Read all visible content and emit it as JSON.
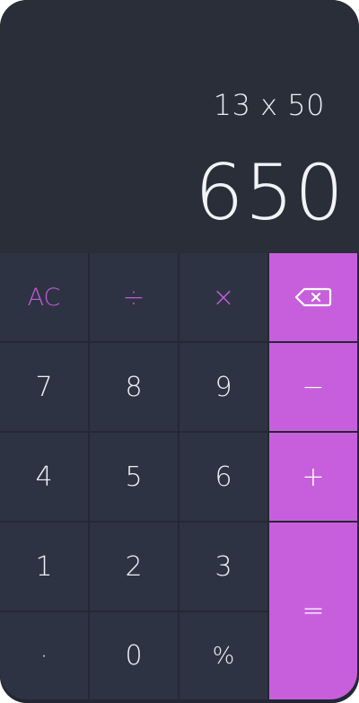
{
  "display": {
    "expression": "13 x 50",
    "result": "650"
  },
  "keys": {
    "clear": "AC",
    "divide": "÷",
    "multiply": "×",
    "backspace": "backspace-icon",
    "seven": "7",
    "eight": "8",
    "nine": "9",
    "minus": "−",
    "four": "4",
    "five": "5",
    "six": "6",
    "plus": "+",
    "one": "1",
    "two": "2",
    "three": "3",
    "equals": "=",
    "decimal": "·",
    "zero": "0",
    "percent": "%"
  },
  "colors": {
    "accent": "#c75fdc",
    "accent_text": "#c25ad8",
    "key_bg": "#2d3342",
    "display_bg": "#292e38"
  }
}
